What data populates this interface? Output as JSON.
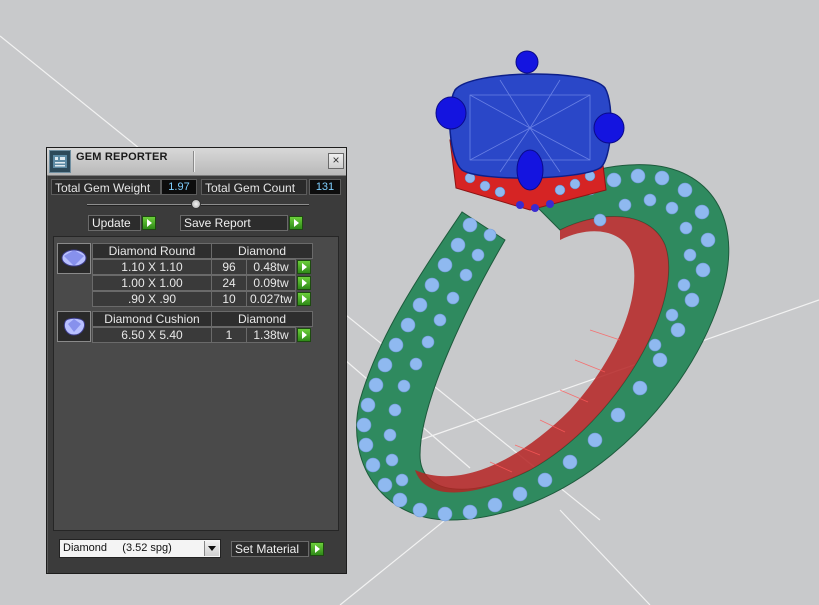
{
  "panel": {
    "title": "GEM REPORTER",
    "close_label": "×",
    "total_weight_label": "Total Gem Weight",
    "total_weight_value": "1.97",
    "total_count_label": "Total Gem Count",
    "total_count_value": "131",
    "update_label": "Update",
    "save_report_label": "Save Report"
  },
  "gem_groups": [
    {
      "name": "Diamond Round",
      "material": "Diamond",
      "rows": [
        {
          "size": "1.10 X 1.10",
          "count": "96",
          "weight": "0.48tw"
        },
        {
          "size": "1.00 X 1.00",
          "count": "24",
          "weight": "0.09tw"
        },
        {
          "size": ".90 X .90",
          "count": "10",
          "weight": "0.027tw"
        }
      ]
    },
    {
      "name": "Diamond Cushion",
      "material": "Diamond",
      "rows": [
        {
          "size": "6.50 X 5.40",
          "count": "1",
          "weight": "1.38tw"
        }
      ]
    }
  ],
  "footer": {
    "material_select": "Diamond     (3.52 spg)",
    "set_material_label": "Set Material"
  },
  "colors": {
    "viewport_bg": "#c8c9cb",
    "ring_band": "#2f8a5f",
    "pave_stones": "#8fb9f0",
    "center_stone": "#1f3fd8",
    "inner_wire": "#d21f1f"
  }
}
